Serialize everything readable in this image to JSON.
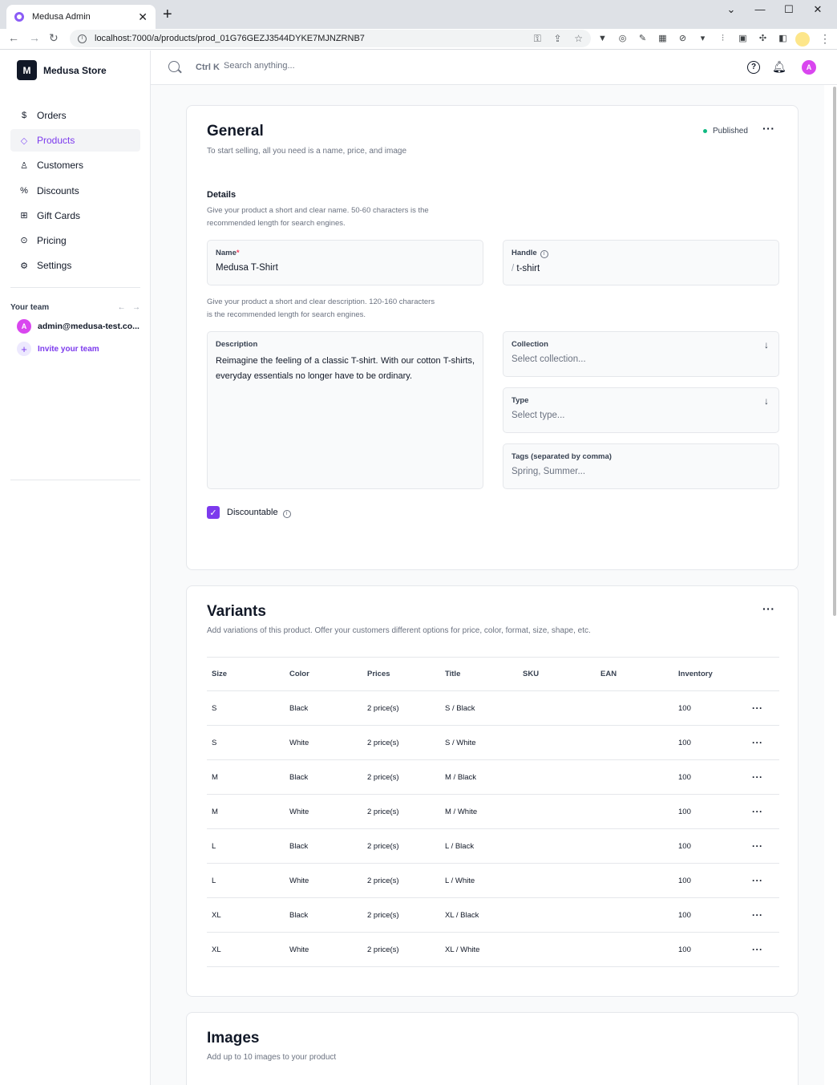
{
  "browser": {
    "tab_title": "Medusa Admin",
    "url": "localhost:7000/a/products/prod_01G76GEZJ3544DYKE7MJNZRNB7"
  },
  "sidebar": {
    "store_initial": "M",
    "store_name": "Medusa Store",
    "items": [
      {
        "label": "Orders",
        "icon": "dollar-icon",
        "glyph": "$"
      },
      {
        "label": "Products",
        "icon": "tag-icon",
        "glyph": "◇"
      },
      {
        "label": "Customers",
        "icon": "user-icon",
        "glyph": "♙"
      },
      {
        "label": "Discounts",
        "icon": "discount-icon",
        "glyph": "%"
      },
      {
        "label": "Gift Cards",
        "icon": "gift-icon",
        "glyph": "⊞"
      },
      {
        "label": "Pricing",
        "icon": "pricing-icon",
        "glyph": "⊙"
      },
      {
        "label": "Settings",
        "icon": "gear-icon",
        "glyph": "⚙"
      }
    ],
    "active_index": 1,
    "team_label": "Your team",
    "member_initial": "A",
    "member_email": "admin@medusa-test.co...",
    "invite_label": "Invite your team"
  },
  "topbar": {
    "shortcut": "Ctrl K",
    "search_placeholder": "Search anything...",
    "user_initial": "A"
  },
  "general": {
    "title": "General",
    "subtitle": "To start selling, all you need is a name, price, and image",
    "status": "Published",
    "details_label": "Details",
    "name_helper": "Give your product a short and clear name. 50-60 characters is the recommended length for search engines.",
    "name_label": "Name",
    "name_required_mark": "*",
    "name_value": "Medusa T-Shirt",
    "handle_label": "Handle",
    "handle_prefix": "/",
    "handle_value": "t-shirt",
    "desc_helper": "Give your product a short and clear description. 120-160 characters is the recommended length for search engines.",
    "description_label": "Description",
    "description_value": "Reimagine the feeling of a classic T-shirt. With our cotton T-shirts, everyday essentials no longer have to be ordinary.",
    "collection_label": "Collection",
    "collection_placeholder": "Select collection...",
    "type_label": "Type",
    "type_placeholder": "Select type...",
    "tags_label": "Tags (separated by comma)",
    "tags_placeholder": "Spring, Summer...",
    "discountable_label": "Discountable",
    "discountable_checked": true
  },
  "variants": {
    "title": "Variants",
    "subtitle": "Add variations of this product. Offer your customers different options for price, color, format, size, shape, etc.",
    "columns": [
      "Size",
      "Color",
      "Prices",
      "Title",
      "SKU",
      "EAN",
      "Inventory"
    ],
    "rows": [
      {
        "size": "S",
        "color": "Black",
        "prices": "2 price(s)",
        "title": "S / Black",
        "sku": "",
        "ean": "",
        "inventory": "100"
      },
      {
        "size": "S",
        "color": "White",
        "prices": "2 price(s)",
        "title": "S / White",
        "sku": "",
        "ean": "",
        "inventory": "100"
      },
      {
        "size": "M",
        "color": "Black",
        "prices": "2 price(s)",
        "title": "M / Black",
        "sku": "",
        "ean": "",
        "inventory": "100"
      },
      {
        "size": "M",
        "color": "White",
        "prices": "2 price(s)",
        "title": "M / White",
        "sku": "",
        "ean": "",
        "inventory": "100"
      },
      {
        "size": "L",
        "color": "Black",
        "prices": "2 price(s)",
        "title": "L / Black",
        "sku": "",
        "ean": "",
        "inventory": "100"
      },
      {
        "size": "L",
        "color": "White",
        "prices": "2 price(s)",
        "title": "L / White",
        "sku": "",
        "ean": "",
        "inventory": "100"
      },
      {
        "size": "XL",
        "color": "Black",
        "prices": "2 price(s)",
        "title": "XL / Black",
        "sku": "",
        "ean": "",
        "inventory": "100"
      },
      {
        "size": "XL",
        "color": "White",
        "prices": "2 price(s)",
        "title": "XL / White",
        "sku": "",
        "ean": "",
        "inventory": "100"
      }
    ]
  },
  "images": {
    "title": "Images",
    "subtitle": "Add up to 10 images to your product"
  },
  "colors": {
    "accent": "#7c3aed",
    "status_published": "#10b981"
  }
}
